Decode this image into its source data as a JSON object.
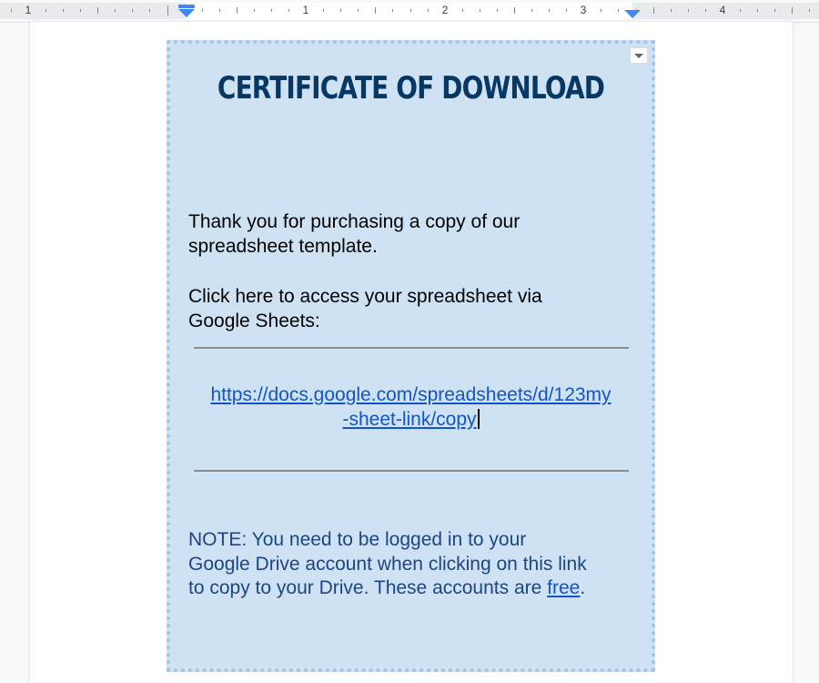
{
  "ruler": {
    "numbers": [
      "1",
      "1",
      "2",
      "3",
      "4"
    ]
  },
  "certificate": {
    "title": "CERTIFICATE OF DOWNLOAD",
    "thanks_line1": "Thank you for purchasing a copy of our",
    "thanks_line2": "spreadsheet template.",
    "click_line1": "Click here to access your spreadsheet via",
    "click_line2": "Google Sheets:",
    "link_line1": "https://docs.google.com/spreadsheets/d/123my",
    "link_line2": "-sheet-link/copy",
    "note_line1": "NOTE: You need to be logged in to your",
    "note_line2": "Google Drive account when clicking on this link",
    "note_line3_prefix": "to copy to your Drive. These accounts are ",
    "note_link": "free",
    "note_suffix": "."
  },
  "colors": {
    "box_background": "#cfe2f3",
    "box_border": "#9fc5e8",
    "title": "#073763",
    "note": "#1c4587",
    "link": "#1155cc",
    "indent_marker": "#4285f4"
  },
  "icons": {
    "table_menu": "chevron-down-icon",
    "left_indent": "left-indent-marker-icon",
    "right_indent": "right-indent-marker-icon"
  }
}
